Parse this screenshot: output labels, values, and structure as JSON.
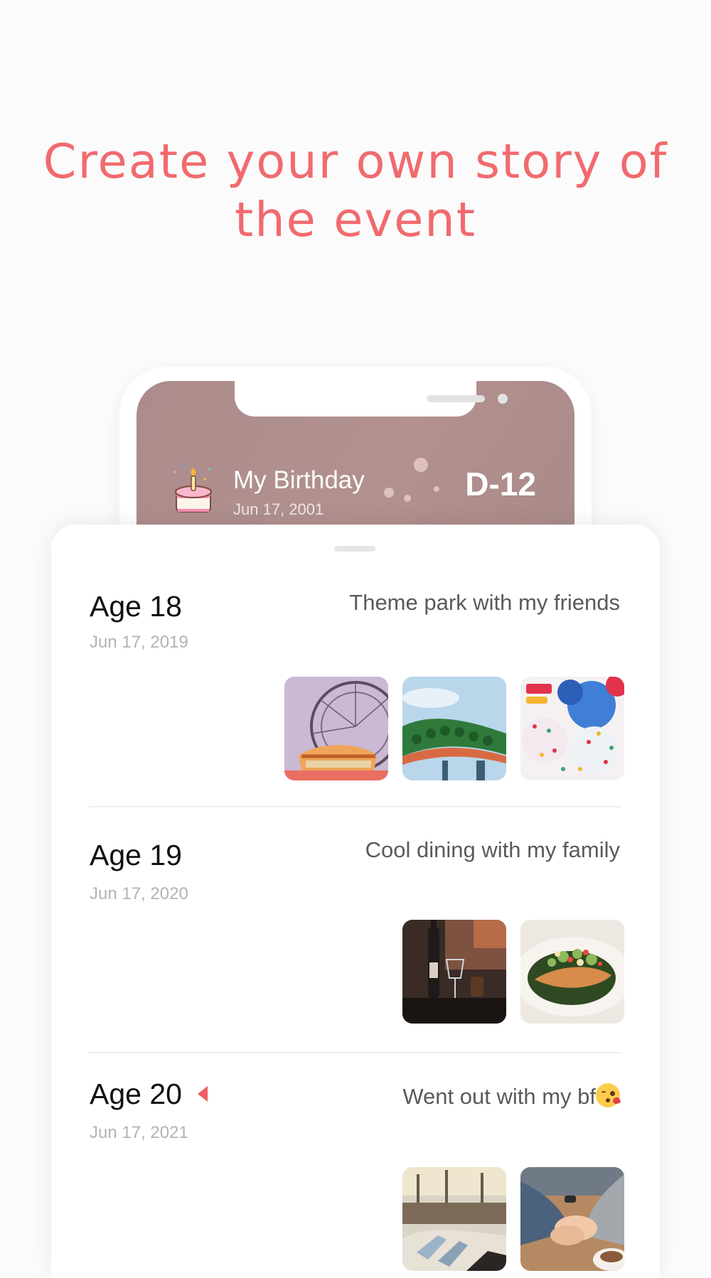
{
  "headline": {
    "line1": "Create your own story of",
    "line2": "the event"
  },
  "event": {
    "icon": "birthday-cake-icon",
    "title": "My Birthday",
    "date": "Jun 17, 2001",
    "dday": "D-12"
  },
  "entries": [
    {
      "age": "Age 18",
      "date": "Jun 17, 2019",
      "caption": "Theme park with my friends",
      "photos": [
        "ferris-wheel-photo",
        "roller-coaster-photo",
        "birthday-balloons-photo"
      ]
    },
    {
      "age": "Age 19",
      "date": "Jun 17, 2020",
      "caption": "Cool dining with my family",
      "photos": [
        "wine-table-photo",
        "salmon-dish-photo"
      ]
    },
    {
      "age": "Age 20",
      "date": "Jun 17, 2021",
      "caption": "Went out with my bf",
      "caption_emoji": "kissing-face-emoji",
      "photos": [
        "relaxing-feet-photo",
        "holding-hands-photo"
      ]
    }
  ],
  "colors": {
    "accent": "#f16a6e",
    "marker": "#ef5f63",
    "header_bg": "#ab8c8b"
  }
}
